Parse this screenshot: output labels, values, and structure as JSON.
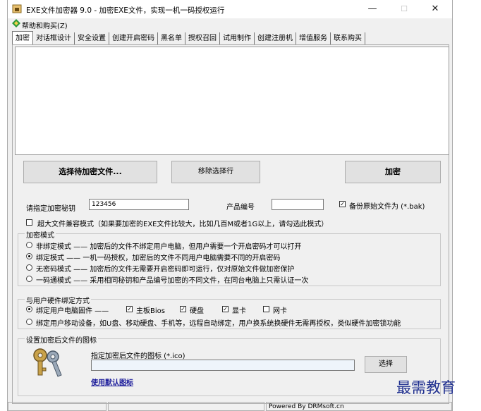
{
  "window": {
    "title": "EXE文件加密器 9.0 - 加密EXE文件，实现一机一码授权运行",
    "controls": {
      "minimize": "—",
      "maximize": "☐",
      "close": "✕"
    }
  },
  "menu": {
    "help": "帮助和购买(Z)"
  },
  "tabs": [
    "加密",
    "对话框设计",
    "安全设置",
    "创建开启密码",
    "黑名单",
    "授权召回",
    "试用制作",
    "创建注册机",
    "增值服务",
    "联系购买"
  ],
  "actions": {
    "select_files": "选择待加密文件...",
    "remove_selected": "移除选择行",
    "encrypt": "加密"
  },
  "key_row": {
    "key_label": "请指定加密秘钥",
    "key_value": "123456",
    "product_label": "产品编号",
    "product_value": "",
    "backup_label": "备份原始文件为 (*.bak)",
    "backup_checked": true
  },
  "large_file": {
    "label": "超大文件兼容模式（如果要加密的EXE文件比较大，比如几百M或者1G以上，请勾选此模式）",
    "checked": false
  },
  "encrypt_mode": {
    "title": "加密模式",
    "options": [
      {
        "label": "非绑定模式 —— 加密后的文件不绑定用户电脑，但用户需要一个开启密码才可以打开",
        "selected": false
      },
      {
        "label": "绑定模式 —— 一机一码授权，加密后的文件不同用户电脑需要不同的开启密码",
        "selected": true
      },
      {
        "label": "无密码模式 —— 加密后的文件无需要开启密码即可运行，仅对原始文件做加密保护",
        "selected": false
      },
      {
        "label": "一码通模式 —— 采用相同秘钥和产品编号加密的不同文件，在同台电脑上只需认证一次",
        "selected": false
      }
    ]
  },
  "hardware_bind": {
    "title": "与用户硬件绑定方式",
    "option_pc": "绑定用户电脑固件 ——",
    "option_pc_selected": true,
    "components": [
      {
        "label": "主板Bios",
        "checked": true
      },
      {
        "label": "硬盘",
        "checked": true
      },
      {
        "label": "显卡",
        "checked": true
      },
      {
        "label": "网卡",
        "checked": false
      }
    ],
    "option_mobile": "绑定用户移动设备，如U盘、移动硬盘、手机等，远程自动绑定，用户换系统换硬件无需再授权，类似硬件加密锁功能",
    "option_mobile_selected": false
  },
  "icon_settings": {
    "title": "设置加密后文件的图标",
    "label": "指定加密后文件的图标 (*.ico)",
    "path_value": "",
    "select_button": "选择",
    "default_link": "使用默认图标"
  },
  "status": {
    "powered": "Powered By DRMsoft.cn"
  },
  "watermark": "最需教育"
}
